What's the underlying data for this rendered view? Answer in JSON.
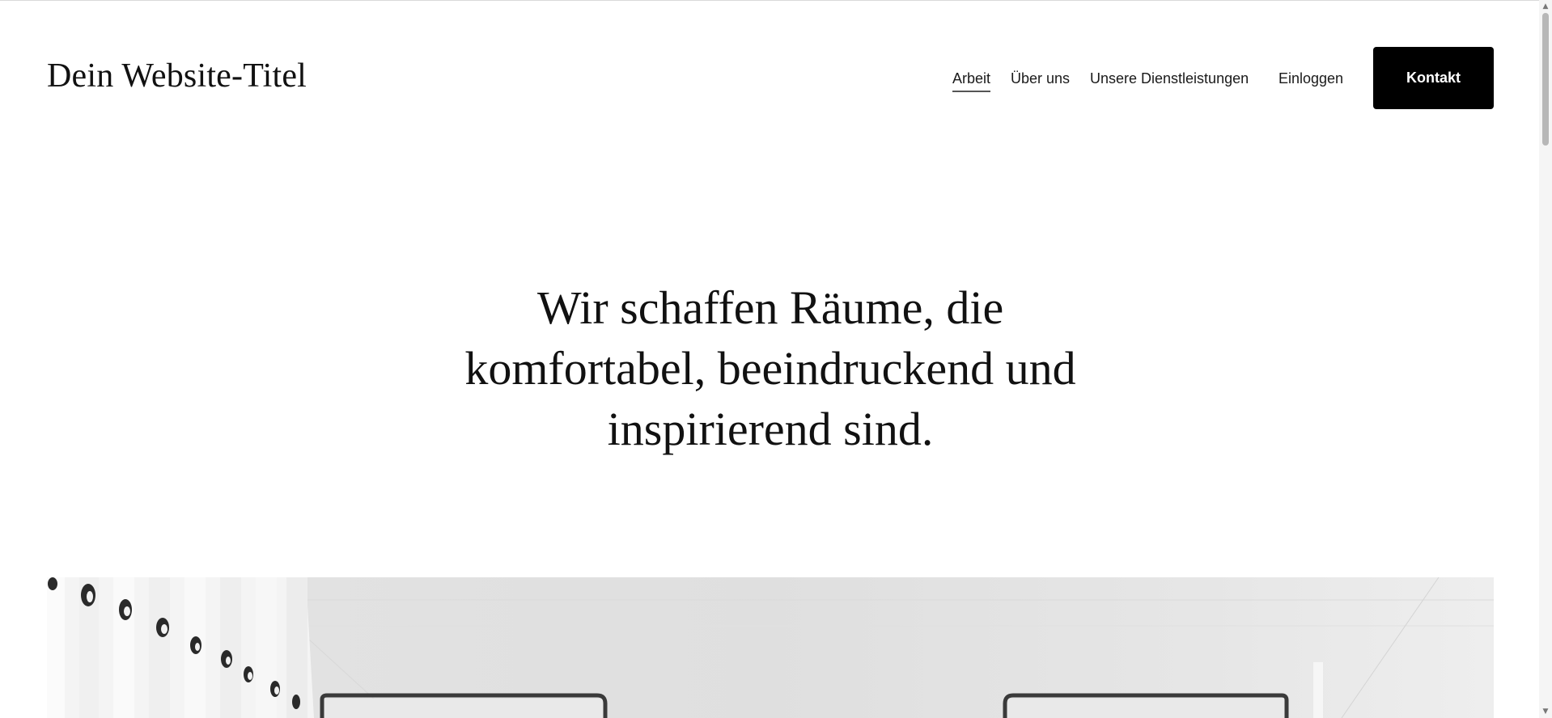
{
  "header": {
    "site_title": "Dein Website-Titel",
    "nav": [
      {
        "label": "Arbeit",
        "active": true
      },
      {
        "label": "Über uns",
        "active": false
      },
      {
        "label": "Unsere Dienstleistungen",
        "active": false
      }
    ],
    "login_label": "Einloggen",
    "contact_label": "Kontakt"
  },
  "hero": {
    "lines": [
      "Wir schaffen Räume, die",
      "komfortabel, beeindruckend und",
      "inspirierend sind."
    ]
  },
  "colors": {
    "background": "#ffffff",
    "text": "#111111",
    "button_background": "#000000",
    "button_text": "#ffffff"
  },
  "icons": {
    "scroll_up": "scroll-up-arrow-icon",
    "scroll_down": "scroll-down-arrow-icon"
  }
}
